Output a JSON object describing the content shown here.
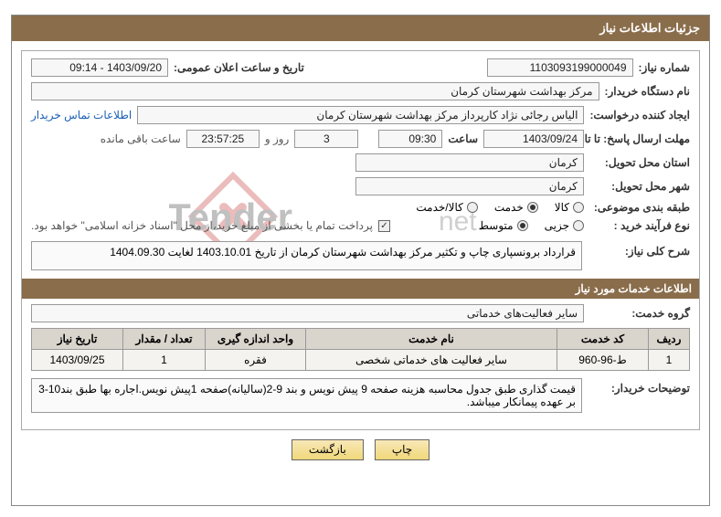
{
  "header": {
    "title": "جزئیات اطلاعات نیاز"
  },
  "fields": {
    "need_no_label": "شماره نیاز:",
    "need_no": "1103093199000049",
    "announce_label": "تاریخ و ساعت اعلان عمومی:",
    "announce_value": "1403/09/20 - 09:14",
    "buyer_org_label": "نام دستگاه خریدار:",
    "buyer_org": "مرکز بهداشت شهرستان کرمان",
    "creator_label": "ایجاد کننده درخواست:",
    "creator": "الیاس رجائی نژاد کارپرداز مرکز بهداشت شهرستان کرمان",
    "buyer_contact_link": "اطلاعات تماس خریدار",
    "deadline_label": "مهلت ارسال پاسخ: تا تاریخ:",
    "deadline_date": "1403/09/24",
    "time_label": "ساعت",
    "deadline_time": "09:30",
    "days_remaining": "3",
    "days_suffix": "روز و",
    "hms_remaining": "23:57:25",
    "hms_suffix": "ساعت باقی مانده",
    "province_label": "استان محل تحویل:",
    "province": "کرمان",
    "city_label": "شهر محل تحویل:",
    "city": "کرمان",
    "subject_class_label": "طبقه بندی موضوعی:",
    "radio_goods": "کالا",
    "radio_service": "خدمت",
    "radio_goods_service": "کالا/خدمت",
    "process_type_label": "نوع فرآیند خرید :",
    "radio_minor": "جزیی",
    "radio_medium": "متوسط",
    "treasury_note": "پرداخت تمام یا بخشی از مبلغ خرید،از محل \"اسناد خزانه اسلامی\" خواهد بود.",
    "overall_desc_label": "شرح کلی نیاز:",
    "overall_desc": "قرارداد برونسپاری چاپ و تکثیر مرکز بهداشت شهرستان کرمان از تاریخ 1403.10.01 لغایت  1404.09.30",
    "section2_title": "اطلاعات خدمات مورد نیاز",
    "service_group_label": "گروه خدمت:",
    "service_group": "سایر فعالیت‌های خدماتی",
    "buyer_notes_label": "توضیحات خریدار:",
    "buyer_notes": "قیمت گذاری طبق جدول محاسبه هزینه صفحه 9 پیش نویس و بند 9-2(سالیانه)صفحه 1پیش نویس.اجاره بها طبق بند10-3 بر عهده پیمانکار میباشد."
  },
  "table": {
    "headers": {
      "row": "ردیف",
      "code": "کد خدمت",
      "name": "نام خدمت",
      "unit": "واحد اندازه گیری",
      "qty": "تعداد / مقدار",
      "date": "تاریخ نیاز"
    },
    "rows": [
      {
        "row": "1",
        "code": "ط-96-960",
        "name": "سایر فعالیت های خدماتی شخصی",
        "unit": "فقره",
        "qty": "1",
        "date": "1403/09/25"
      }
    ]
  },
  "buttons": {
    "print": "چاپ",
    "back": "بازگشت"
  },
  "watermark_text": "AriaTender.net"
}
